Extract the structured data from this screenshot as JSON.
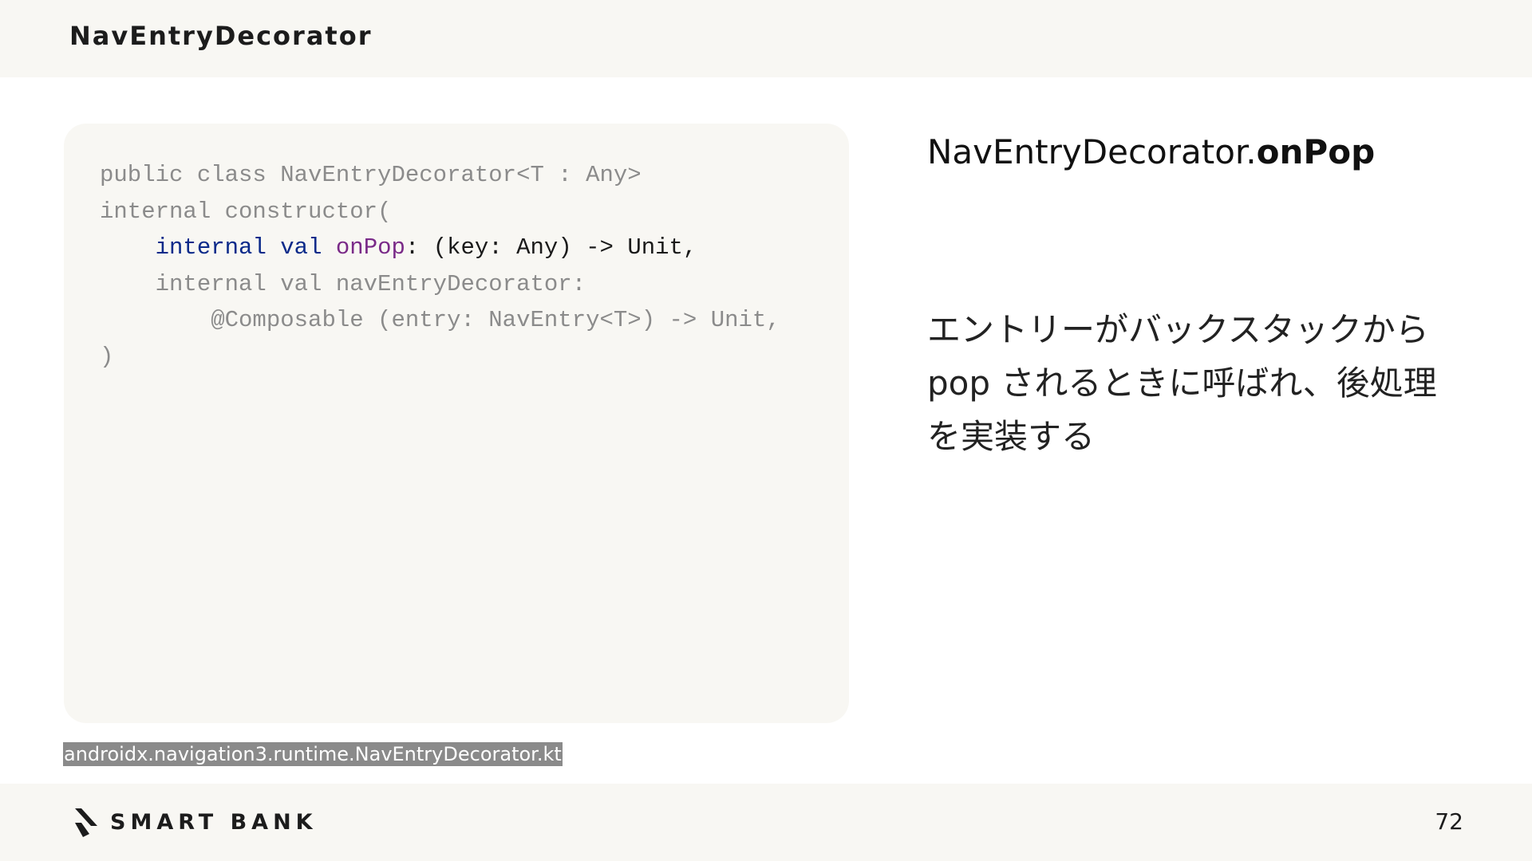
{
  "header": {
    "title": "NavEntryDecorator"
  },
  "code": {
    "lines": [
      "public class NavEntryDecorator<T : Any>",
      "internal constructor(",
      "    internal val onPop: (key: Any) -> Unit,",
      "    internal val navEntryDecorator:",
      "        @Composable (entry: NavEntry<T>) -> Unit,",
      ")"
    ],
    "highlight": {
      "indent": "    ",
      "modifier": "internal",
      "space1": " ",
      "keyword": "val",
      "space2": " ",
      "name": "onPop",
      "rest": ": (key: Any) -> Unit,"
    }
  },
  "source_file": "androidx.navigation3.runtime.NavEntryDecorator.kt",
  "main": {
    "title_prefix": "NavEntryDecorator.",
    "title_strong": "onPop",
    "description": "エントリーがバックスタックから\npop されるときに呼ばれ、後処理\nを実装する"
  },
  "footer": {
    "logo_text": "SMART BANK",
    "logo_icon": "smartbank-mark-icon",
    "page_number": "72"
  },
  "colors": {
    "background": "#ffffff",
    "panel": "#f8f7f3",
    "code_dim": "#8b8b8b",
    "code_keyword": "#0b2a8a",
    "code_identifier": "#7a2a88",
    "label_bg": "#8a8a8a"
  }
}
